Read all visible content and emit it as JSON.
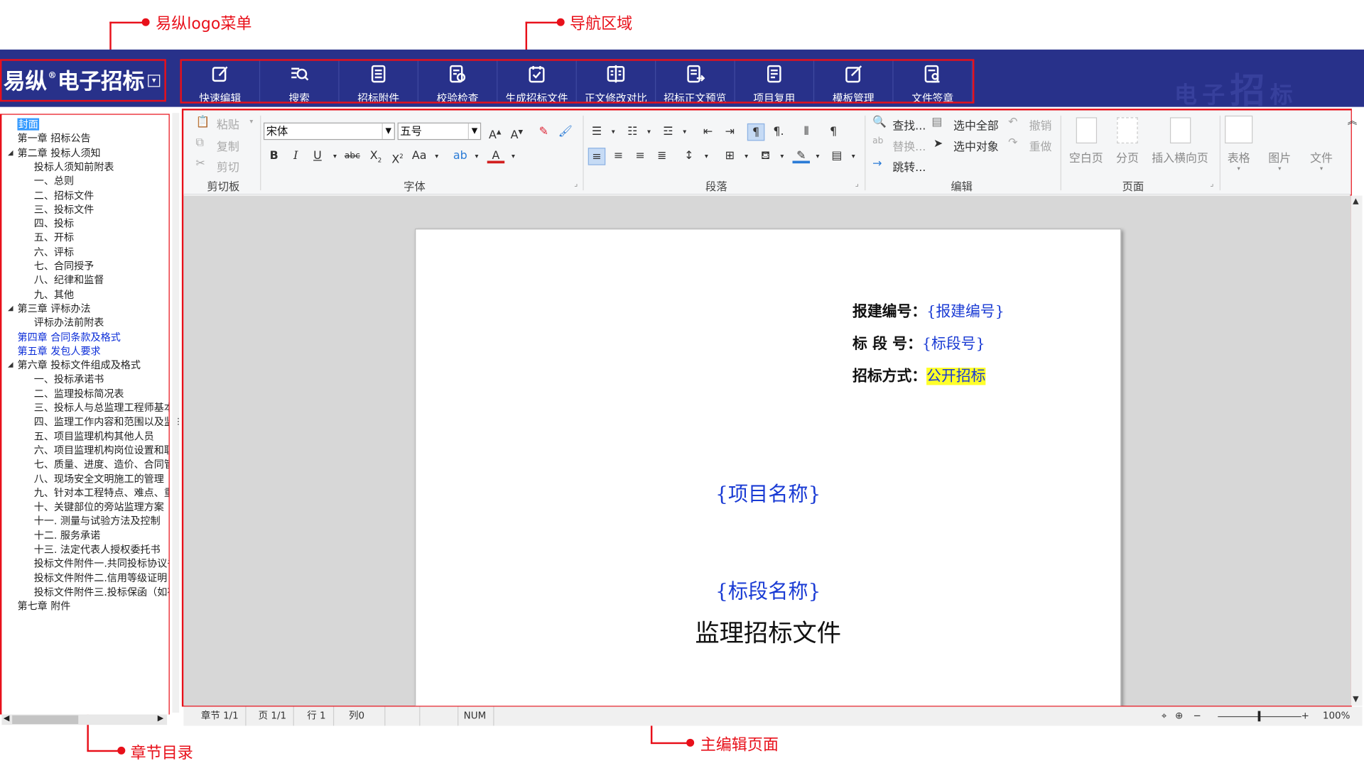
{
  "annotations": {
    "logo_menu": "易纵logo菜单",
    "nav_area": "导航区域",
    "chapter_toc": "章节目录",
    "main_editor": "主编辑页面",
    "color": "#e8101a"
  },
  "app": {
    "logo_text": "易纵",
    "logo_reg": "®",
    "logo_suffix": "电子招标",
    "dropdown_glyph": "▾",
    "watermark_a": "电子",
    "watermark_b": "招",
    "watermark_c": "标",
    "band_color": "#28318a"
  },
  "nav": [
    {
      "label": "快速编辑",
      "icon": "quick-edit-icon"
    },
    {
      "label": "搜索",
      "icon": "search-icon"
    },
    {
      "label": "招标附件",
      "icon": "attachment-doc-icon"
    },
    {
      "label": "校验检查",
      "icon": "check-doc-icon"
    },
    {
      "label": "生成招标文件",
      "icon": "generate-doc-icon"
    },
    {
      "label": "正文修改对比",
      "icon": "compare-icon"
    },
    {
      "label": "招标正文预览",
      "icon": "preview-icon"
    },
    {
      "label": "项目复用",
      "icon": "reuse-icon"
    },
    {
      "label": "模板管理",
      "icon": "template-icon"
    },
    {
      "label": "文件签章",
      "icon": "sign-icon"
    }
  ],
  "tree": [
    {
      "label": "封面",
      "level": 0,
      "selected": true
    },
    {
      "label": "第一章 招标公告",
      "level": 0
    },
    {
      "label": "第二章 投标人须知",
      "level": 0,
      "expanded": true
    },
    {
      "label": "投标人须知前附表",
      "level": 1
    },
    {
      "label": "一、总则",
      "level": 1
    },
    {
      "label": "二、招标文件",
      "level": 1
    },
    {
      "label": "三、投标文件",
      "level": 1
    },
    {
      "label": "四、投标",
      "level": 1
    },
    {
      "label": "五、开标",
      "level": 1
    },
    {
      "label": "六、评标",
      "level": 1
    },
    {
      "label": "七、合同授予",
      "level": 1
    },
    {
      "label": "八、纪律和监督",
      "level": 1
    },
    {
      "label": "九、其他",
      "level": 1
    },
    {
      "label": "第三章 评标办法",
      "level": 0,
      "expanded": true
    },
    {
      "label": "评标办法前附表",
      "level": 1
    },
    {
      "label": "第四章 合同条款及格式",
      "level": 0,
      "blue": true
    },
    {
      "label": "第五章 发包人要求",
      "level": 0,
      "blue": true
    },
    {
      "label": "第六章 投标文件组成及格式",
      "level": 0,
      "expanded": true
    },
    {
      "label": "一、投标承诺书",
      "level": 1
    },
    {
      "label": "二、监理投标简况表",
      "level": 1
    },
    {
      "label": "三、投标人与总监理工程师基本情况",
      "level": 1
    },
    {
      "label": "四、监理工作内容和范围以及监理目标",
      "level": 1
    },
    {
      "label": "五、项目监理机构其他人员",
      "level": 1
    },
    {
      "label": "六、项目监理机构岗位设置和职责",
      "level": 1
    },
    {
      "label": "七、质量、进度、造价、合同管理",
      "level": 1
    },
    {
      "label": "八、现场安全文明施工的管理",
      "level": 1
    },
    {
      "label": "九、针对本工程特点、难点、重点",
      "level": 1
    },
    {
      "label": "十、关键部位的旁站监理方案",
      "level": 1
    },
    {
      "label": "十一. 测量与试验方法及控制",
      "level": 1
    },
    {
      "label": "十二. 服务承诺",
      "level": 1
    },
    {
      "label": "十三. 法定代表人授权委托书",
      "level": 1
    },
    {
      "label": "投标文件附件一.共同投标协议书",
      "level": 1
    },
    {
      "label": "投标文件附件二.信用等级证明",
      "level": 1
    },
    {
      "label": "投标文件附件三.投标保函（如有）",
      "level": 1
    },
    {
      "label": "第七章 附件",
      "level": 0
    }
  ],
  "ribbon": {
    "clipboard": {
      "paste": "粘贴",
      "copy": "复制",
      "cut": "剪切",
      "group": "剪切板"
    },
    "font": {
      "face": "宋体",
      "size": "五号",
      "group": "字体"
    },
    "paragraph": {
      "group": "段落"
    },
    "edit": {
      "find": "查找...",
      "replace": "替换...",
      "goto": "跳转...",
      "select_all": "选中全部",
      "select_obj": "选中对象",
      "undo": "撤销",
      "redo": "重做",
      "group": "编辑"
    },
    "page": {
      "blank": "空白页",
      "break": "分页",
      "landscape": "插入横向页",
      "group": "页面"
    },
    "insert": {
      "table": "表格",
      "image": "图片",
      "file": "文件"
    }
  },
  "document": {
    "rows": [
      {
        "k": "报建编号：",
        "v": "{报建编号}",
        "hl": false
      },
      {
        "k": "标  段  号：",
        "v": "{标段号}",
        "hl": false
      },
      {
        "k": "招标方式：",
        "v": "公开招标",
        "hl": true
      }
    ],
    "project_name": "{项目名称}",
    "section_name": "{标段名称}",
    "title": "监理招标文件"
  },
  "status": {
    "chapter": "章节 1/1",
    "page": "页 1/1",
    "line": "行 1",
    "col": "列0",
    "num": "NUM",
    "zoom_minus": "−",
    "zoom_plus": "+",
    "zoom": "100%"
  }
}
